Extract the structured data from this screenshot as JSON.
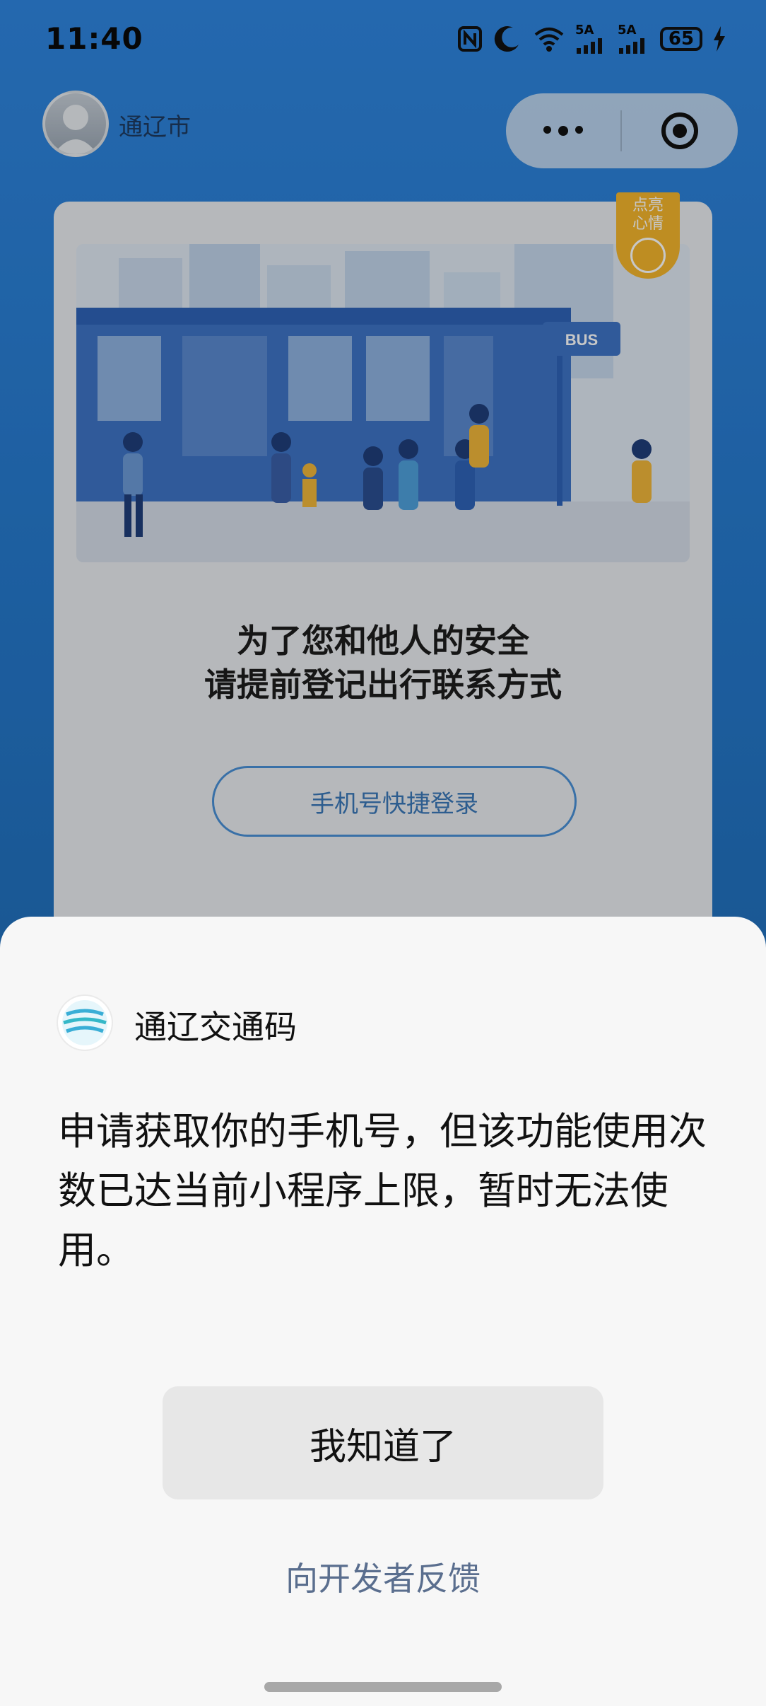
{
  "status_bar": {
    "time": "11:40",
    "network_1": "5A",
    "network_2": "5A",
    "battery": "65"
  },
  "header": {
    "city": "通辽市"
  },
  "card": {
    "badge_line1": "点亮",
    "badge_line2": "心情",
    "illustration_sign": "BUS",
    "title_line1": "为了您和他人的安全",
    "title_line2": "请提前登记出行联系方式",
    "login_button": "手机号快捷登录"
  },
  "sheet": {
    "app_name": "通辽交通码",
    "message": "申请获取你的手机号，但该功能使用次数已达当前小程序上限，暂时无法使用。",
    "ok_button": "我知道了",
    "feedback_link": "向开发者反馈"
  },
  "colors": {
    "accent": "#4a90d6",
    "badge": "#f4b52c",
    "sheet_bg": "#f7f7f7"
  }
}
